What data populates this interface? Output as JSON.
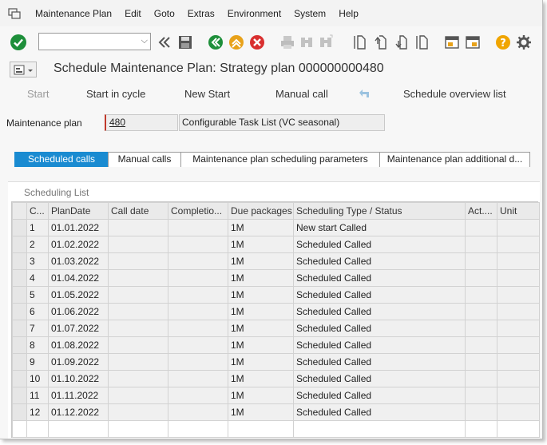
{
  "menu": [
    "Maintenance Plan",
    "Edit",
    "Goto",
    "Extras",
    "Environment",
    "System",
    "Help"
  ],
  "toolbar": {
    "command_field_value": "",
    "icons": [
      "enter-icon",
      "command-dropdown-icon",
      "collapse-icon",
      "save-icon",
      "back-icon",
      "exit-icon",
      "cancel-icon",
      "print-icon",
      "find-icon",
      "find-next-icon",
      "first-page-icon",
      "previous-page-icon",
      "next-page-icon",
      "last-page-icon",
      "new-session-icon",
      "shortcut-icon",
      "help-icon",
      "settings-icon"
    ],
    "colors": {
      "enter": "#1e8f3a",
      "back": "#1e8f3a",
      "exit": "#e8a21a",
      "cancel": "#d93030",
      "help": "#f0a500"
    }
  },
  "title": "Schedule Maintenance Plan: Strategy plan 000000000480",
  "app_toolbar": {
    "start": "Start",
    "start_in_cycle": "Start in cycle",
    "new_start": "New Start",
    "manual_call": "Manual call",
    "schedule_overview_list": "Schedule overview list"
  },
  "header": {
    "maintenance_plan_label": "Maintenance plan",
    "maintenance_plan_value": "480",
    "maintenance_plan_desc": "Configurable Task List (VC seasonal)"
  },
  "tabs": [
    {
      "label": "Scheduled calls",
      "active": true
    },
    {
      "label": "Manual calls",
      "active": false
    },
    {
      "label": "Maintenance plan scheduling parameters",
      "active": false
    },
    {
      "label": "Maintenance plan additional d...",
      "active": false
    }
  ],
  "scheduling_list": {
    "title": "Scheduling List",
    "columns": [
      "C...",
      "PlanDate",
      "Call date",
      "Completio...",
      "Due packages",
      "Scheduling Type / Status",
      "Act....",
      "Unit"
    ],
    "rows": [
      [
        "1",
        "01.01.2022",
        "",
        "",
        "1M",
        "New start  Called",
        "",
        ""
      ],
      [
        "2",
        "01.02.2022",
        "",
        "",
        "1M",
        "Scheduled  Called",
        "",
        ""
      ],
      [
        "3",
        "01.03.2022",
        "",
        "",
        "1M",
        "Scheduled  Called",
        "",
        ""
      ],
      [
        "4",
        "01.04.2022",
        "",
        "",
        "1M",
        "Scheduled  Called",
        "",
        ""
      ],
      [
        "5",
        "01.05.2022",
        "",
        "",
        "1M",
        "Scheduled  Called",
        "",
        ""
      ],
      [
        "6",
        "01.06.2022",
        "",
        "",
        "1M",
        "Scheduled  Called",
        "",
        ""
      ],
      [
        "7",
        "01.07.2022",
        "",
        "",
        "1M",
        "Scheduled  Called",
        "",
        ""
      ],
      [
        "8",
        "01.08.2022",
        "",
        "",
        "1M",
        "Scheduled  Called",
        "",
        ""
      ],
      [
        "9",
        "01.09.2022",
        "",
        "",
        "1M",
        "Scheduled  Called",
        "",
        ""
      ],
      [
        "10",
        "01.10.2022",
        "",
        "",
        "1M",
        "Scheduled  Called",
        "",
        ""
      ],
      [
        "11",
        "01.11.2022",
        "",
        "",
        "1M",
        "Scheduled  Called",
        "",
        ""
      ],
      [
        "12",
        "01.12.2022",
        "",
        "",
        "1M",
        "Scheduled  Called",
        "",
        ""
      ]
    ]
  }
}
